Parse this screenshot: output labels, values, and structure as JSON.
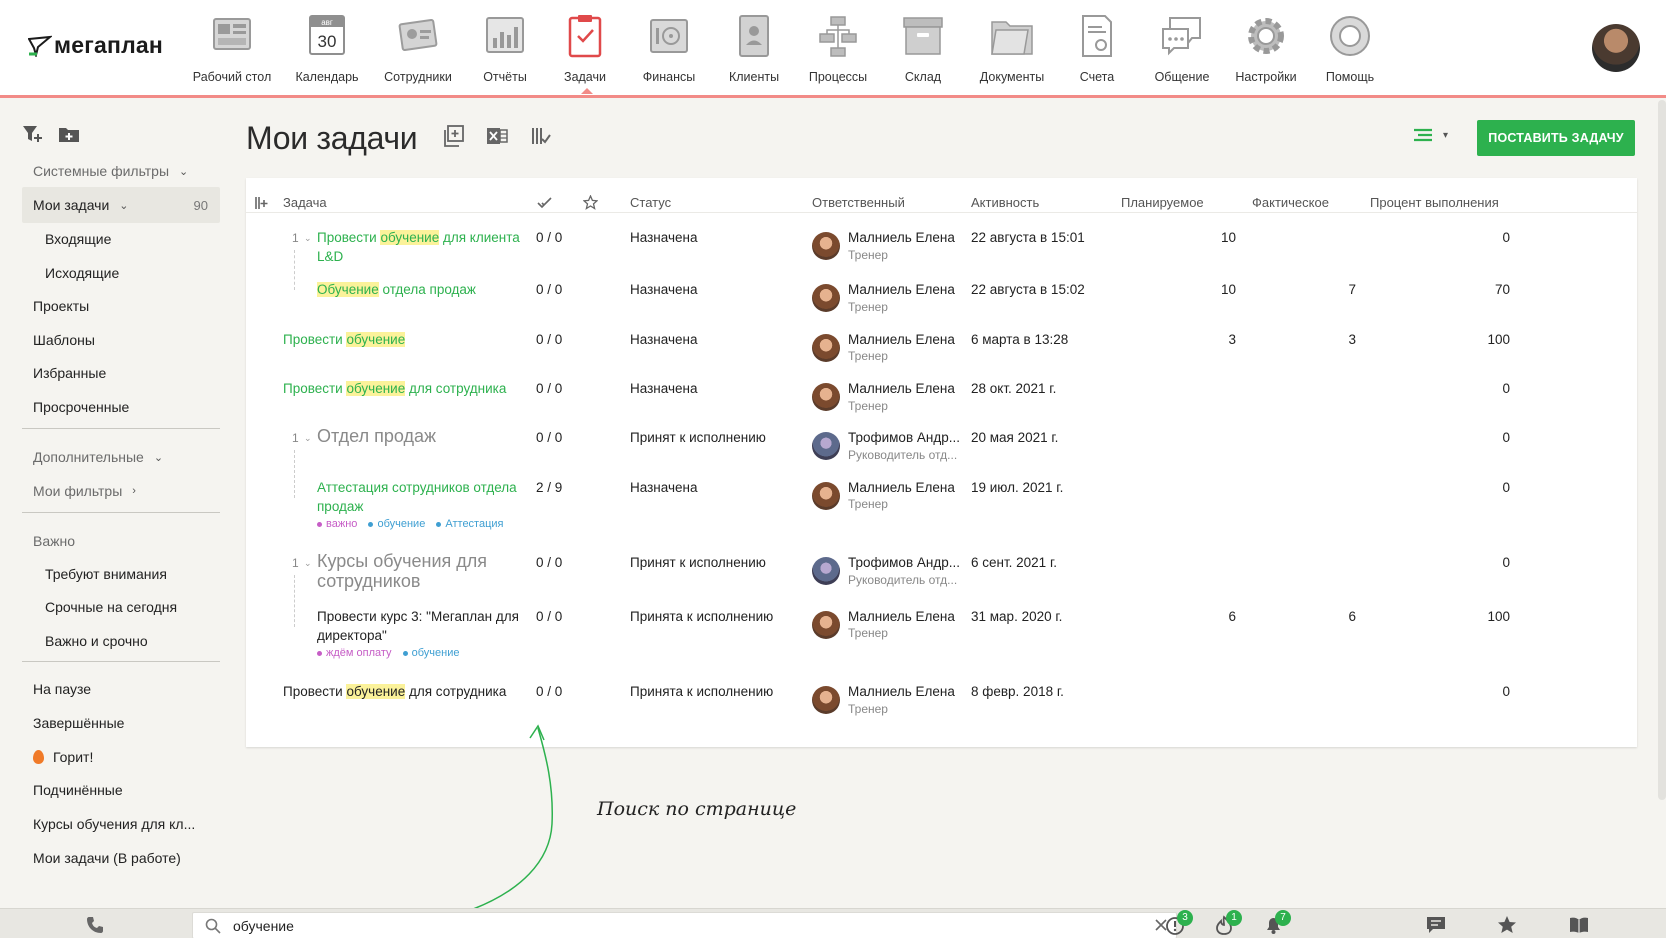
{
  "app": {
    "logo_text": "мегаплан"
  },
  "nav": {
    "items": [
      {
        "label": "Рабочий стол",
        "icon": "desktop-icon"
      },
      {
        "label": "Календарь",
        "icon": "calendar-icon",
        "cal_month": "авг",
        "cal_day": "30"
      },
      {
        "label": "Сотрудники",
        "icon": "employees-icon"
      },
      {
        "label": "Отчёты",
        "icon": "reports-icon"
      },
      {
        "label": "Задачи",
        "icon": "tasks-icon",
        "active": true
      },
      {
        "label": "Финансы",
        "icon": "finance-icon"
      },
      {
        "label": "Клиенты",
        "icon": "clients-icon"
      },
      {
        "label": "Процессы",
        "icon": "processes-icon"
      },
      {
        "label": "Склад",
        "icon": "warehouse-icon"
      },
      {
        "label": "Документы",
        "icon": "documents-icon"
      },
      {
        "label": "Счета",
        "icon": "invoices-icon"
      },
      {
        "label": "Общение",
        "icon": "communication-icon"
      },
      {
        "label": "Настройки",
        "icon": "settings-icon"
      },
      {
        "label": "Помощь",
        "icon": "help-icon"
      }
    ]
  },
  "sidebar": {
    "system_filters": "Системные фильтры",
    "my_tasks": "Мои задачи",
    "my_tasks_count": "90",
    "incoming": "Входящие",
    "outgoing": "Исходящие",
    "projects": "Проекты",
    "templates": "Шаблоны",
    "favorites": "Избранные",
    "overdue": "Просроченные",
    "additional": "Дополнительные",
    "my_filters": "Мои фильтры",
    "important": "Важно",
    "need_attention": "Требуют внимания",
    "urgent_today": "Срочные на сегодня",
    "important_urgent": "Важно и срочно",
    "paused": "На паузе",
    "completed": "Завершённые",
    "burning": "Горит!",
    "subordinates": "Подчинённые",
    "custom_filter_1": "Курсы обучения для кл...",
    "custom_filter_2": "Мои задачи (В работе)"
  },
  "page": {
    "title": "Мои задачи",
    "create_button": "ПОСТАВИТЬ ЗАДАЧУ"
  },
  "table": {
    "headers": {
      "task": "Задача",
      "status": "Статус",
      "responsible": "Ответственный",
      "activity": "Активность",
      "planned": "Планируемое",
      "actual": "Фактическое",
      "percent": "Процент выполнения"
    },
    "rows": [
      {
        "num": "1",
        "title_parts": [
          "Провести ",
          "обучение",
          " для клиента L&D"
        ],
        "subtasks": "0 / 0",
        "status": "Назначена",
        "person": "Малниель Елена",
        "role": "Тренер",
        "activity": "22 августа в 15:01",
        "planned": "10",
        "actual": "",
        "percent": "0"
      },
      {
        "num": "",
        "title_parts": [
          "",
          "Обучение",
          " отдела продаж"
        ],
        "subtasks": "0 / 0",
        "status": "Назначена",
        "person": "Малниель Елена",
        "role": "Тренер",
        "activity": "22 августа в 15:02",
        "planned": "10",
        "actual": "7",
        "percent": "70"
      },
      {
        "num": "",
        "title_parts": [
          "Провести ",
          "обучение",
          ""
        ],
        "subtasks": "0 / 0",
        "status": "Назначена",
        "person": "Малниель Елена",
        "role": "Тренер",
        "activity": "6 марта в 13:28",
        "planned": "3",
        "actual": "3",
        "percent": "100"
      },
      {
        "num": "",
        "title_parts": [
          "Провести ",
          "обучение",
          " для сотрудника"
        ],
        "subtasks": "0 / 0",
        "status": "Назначена",
        "person": "Малниель Елена",
        "role": "Тренер",
        "activity": "28 окт. 2021 г.",
        "planned": "",
        "actual": "",
        "percent": "0"
      },
      {
        "num": "1",
        "title": "Отдел продаж",
        "subtasks": "0 / 0",
        "status": "Принят к исполнению",
        "person": "Трофимов Андр...",
        "role": "Руководитель отд...",
        "activity": "20 мая 2021 г.",
        "planned": "",
        "actual": "",
        "percent": "0"
      },
      {
        "num": "",
        "title": "Аттестация сотрудников отдела продаж",
        "tags": [
          "важно",
          "обучение",
          "Аттестация"
        ],
        "subtasks": "2 / 9",
        "status": "Назначена",
        "person": "Малниель Елена",
        "role": "Тренер",
        "activity": "19 июл. 2021 г.",
        "planned": "",
        "actual": "",
        "percent": "0"
      },
      {
        "num": "1",
        "title": "Курсы обучения для сотрудников",
        "subtasks": "0 / 0",
        "status": "Принят к исполнению",
        "person": "Трофимов Андр...",
        "role": "Руководитель отд...",
        "activity": "6 сент. 2021 г.",
        "planned": "",
        "actual": "",
        "percent": "0"
      },
      {
        "num": "",
        "title": "Провести курс 3: \"Мегаплан для директора\"",
        "tags": [
          "ждём оплату",
          "обучение"
        ],
        "subtasks": "0 / 0",
        "status": "Принята к исполнению",
        "person": "Малниель Елена",
        "role": "Тренер",
        "activity": "31 мар. 2020 г.",
        "planned": "6",
        "actual": "6",
        "percent": "100"
      },
      {
        "num": "",
        "title_parts": [
          "Провести ",
          "обучение",
          " для сотрудника"
        ],
        "subtasks": "0 / 0",
        "status": "Принята к исполнению",
        "person": "Малниель Елена",
        "role": "Тренер",
        "activity": "8 февр. 2018 г.",
        "planned": "",
        "actual": "",
        "percent": "0"
      }
    ]
  },
  "annotation": {
    "text": "Поиск по странице"
  },
  "bottombar": {
    "search_value": "обучение",
    "badges": {
      "alerts": "3",
      "burning": "1",
      "notifications": "7"
    }
  },
  "colors": {
    "accent": "#2db14e",
    "nav_underline": "#f28b87",
    "highlight": "#fbf29a"
  }
}
